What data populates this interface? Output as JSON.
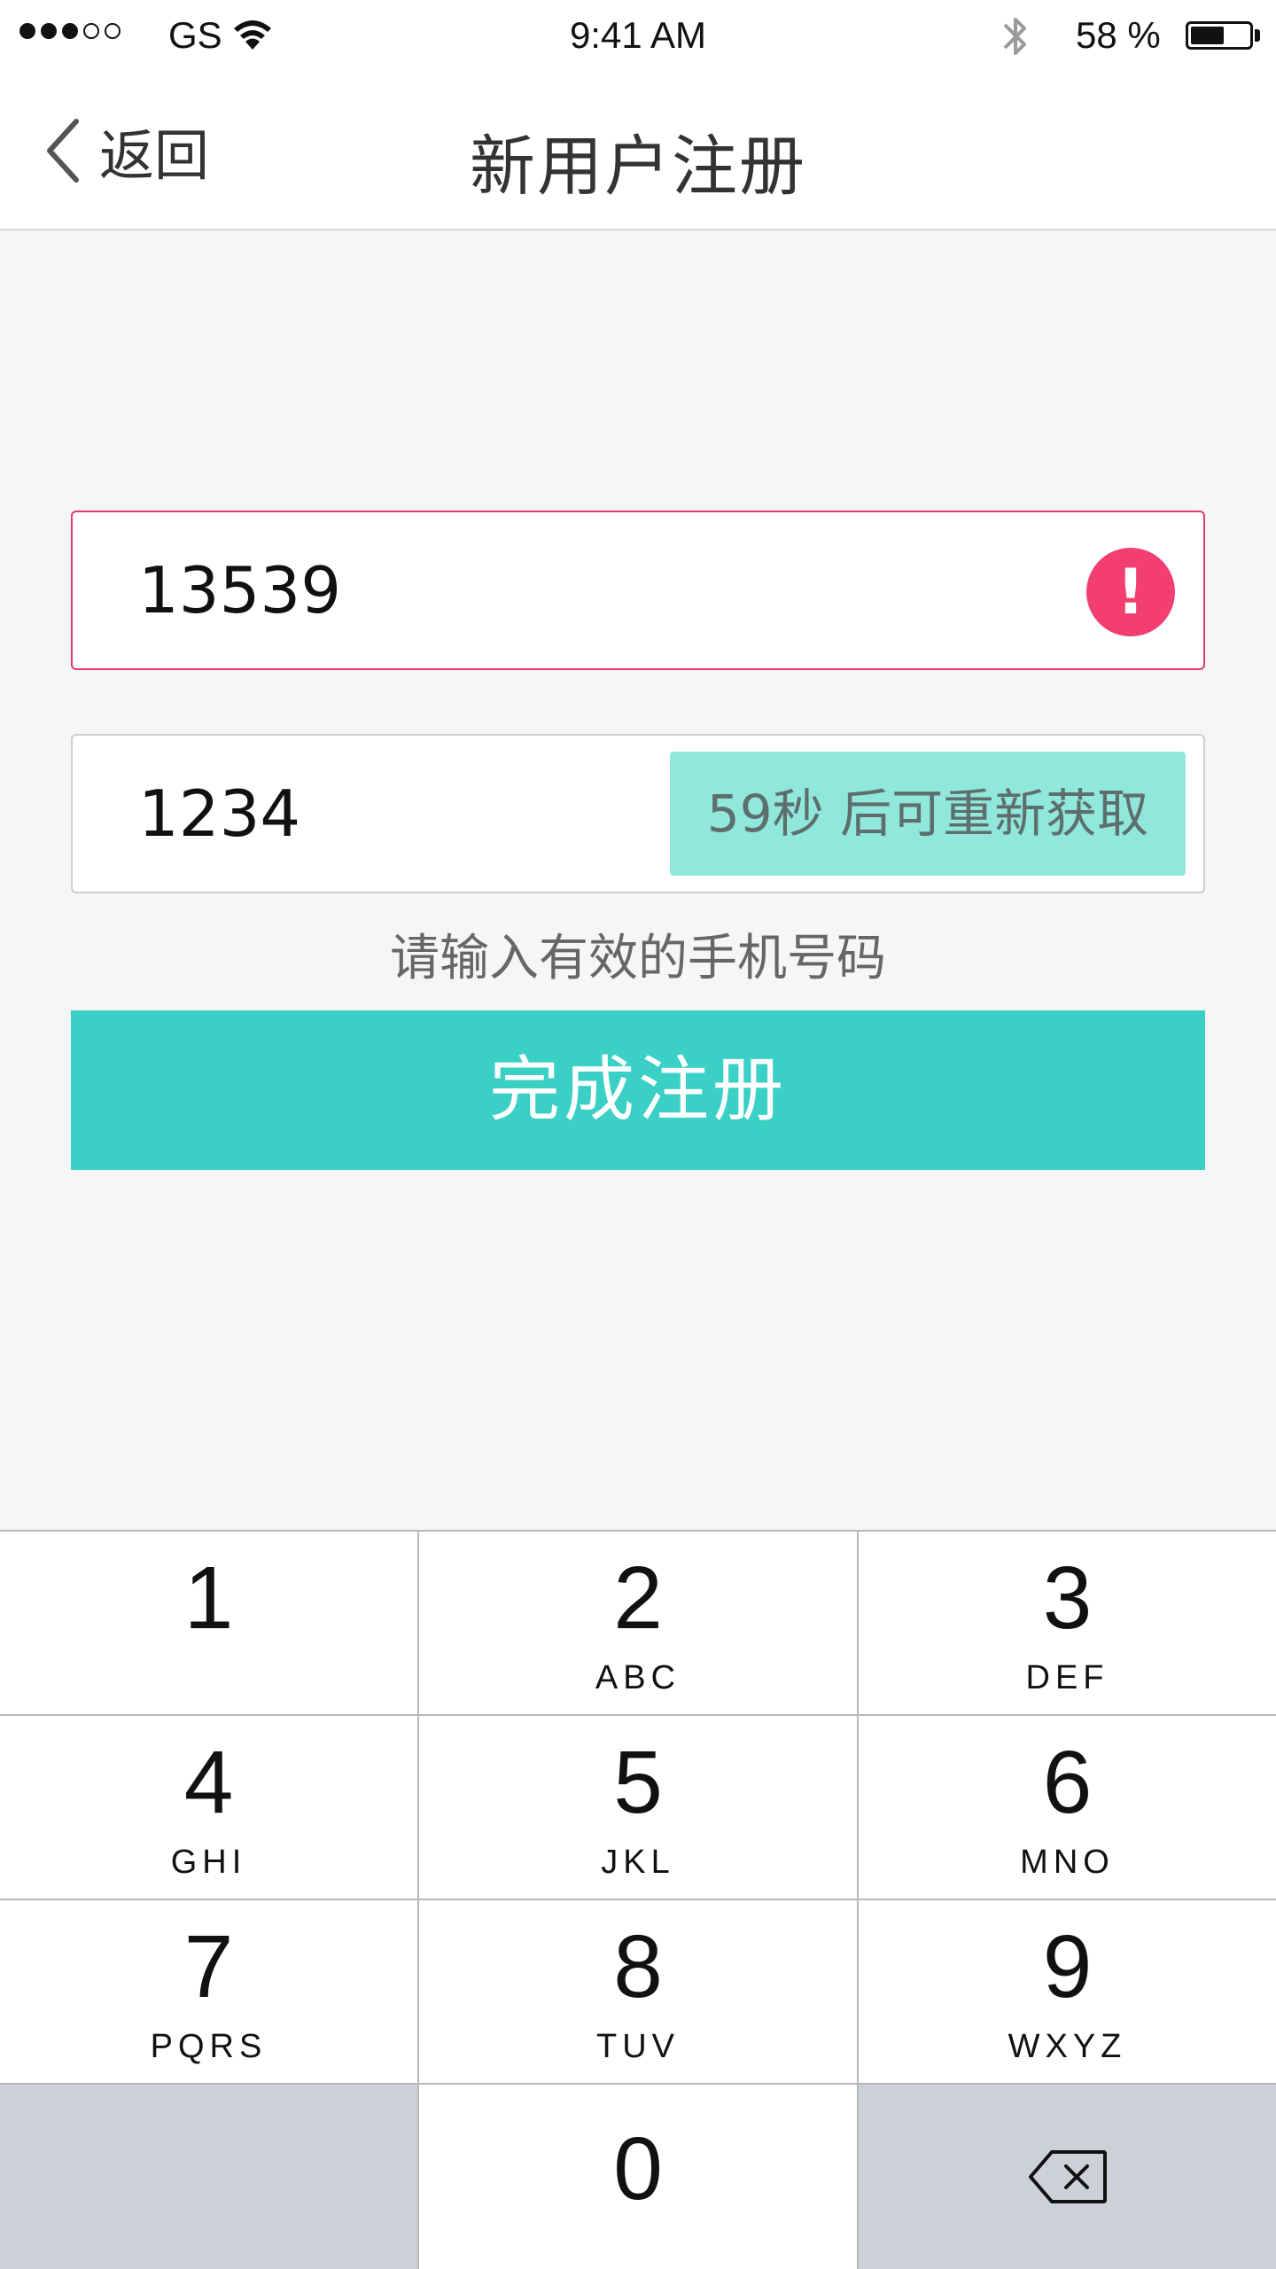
{
  "status_bar": {
    "carrier": "GS",
    "time": "9:41 AM",
    "battery_text": "58 %",
    "battery_level": 0.58,
    "signal_filled": 3,
    "signal_total": 5
  },
  "nav": {
    "back_label": "返回",
    "title": "新用户注册"
  },
  "form": {
    "phone_value": "13539",
    "error_icon_glyph": "!",
    "code_value": "1234",
    "resend_label": "59秒 后可重新获取",
    "hint": "请输入有效的手机号码",
    "submit_label": "完成注册"
  },
  "keypad": {
    "keys": [
      {
        "digit": "1",
        "letters": ""
      },
      {
        "digit": "2",
        "letters": "ABC"
      },
      {
        "digit": "3",
        "letters": "DEF"
      },
      {
        "digit": "4",
        "letters": "GHI"
      },
      {
        "digit": "5",
        "letters": "JKL"
      },
      {
        "digit": "6",
        "letters": "MNO"
      },
      {
        "digit": "7",
        "letters": "PQRS"
      },
      {
        "digit": "8",
        "letters": "TUV"
      },
      {
        "digit": "9",
        "letters": "WXYZ"
      },
      {
        "digit": "0",
        "letters": ""
      }
    ]
  },
  "colors": {
    "accent": "#3ad0c5",
    "resend_bg": "#90e7dc",
    "error": "#f23f70",
    "error_border": "#e23a6e",
    "background": "#f5f6f6"
  },
  "icons": {
    "back": "chevron-left-icon",
    "error": "exclamation-icon",
    "wifi": "wifi-icon",
    "bluetooth": "bluetooth-icon",
    "battery": "battery-icon",
    "delete": "backspace-icon"
  }
}
